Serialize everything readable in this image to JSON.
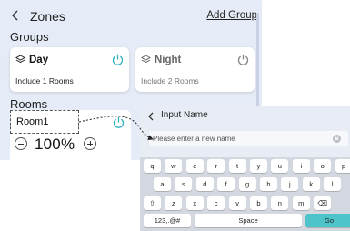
{
  "zones": {
    "title": "Zones",
    "add_group_label": "Add Group",
    "groups_label": "Groups",
    "groups": [
      {
        "name": "Day",
        "subtitle": "Include 1 Rooms",
        "active": true,
        "icon": "layers-icon",
        "power_icon": "power-icon",
        "accent": "#2fb2c0"
      },
      {
        "name": "Night",
        "subtitle": "Include 2 Rooms",
        "active": false,
        "icon": "layers-icon",
        "power_icon": "power-icon",
        "accent": "#888888"
      }
    ],
    "rooms_label": "Rooms",
    "room": {
      "name": "Room1",
      "level": "100%",
      "power_icon": "power-icon",
      "accent": "#2fb2c0"
    }
  },
  "input_dialog": {
    "title": "Input Name",
    "placeholder": "Please enter a new name",
    "value": ""
  },
  "keyboard": {
    "row1": [
      "q",
      "w",
      "e",
      "r",
      "t",
      "y",
      "u",
      "i",
      "o",
      "p"
    ],
    "row2": [
      "a",
      "s",
      "d",
      "f",
      "g",
      "h",
      "j",
      "k",
      "l"
    ],
    "row3": [
      "⇧",
      "z",
      "x",
      "c",
      "v",
      "b",
      "n",
      "m",
      "⌫"
    ],
    "bottom": {
      "symbols": "123,.@#",
      "space": "Space",
      "go": "Go"
    },
    "go_color": "#4cc4c9"
  }
}
